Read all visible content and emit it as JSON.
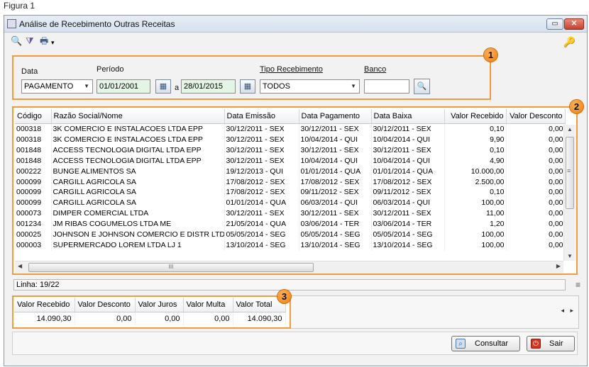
{
  "caption": "Figura 1",
  "window": {
    "title": "Análise de Recebimento Outras Receitas",
    "min_label": "▭",
    "close_label": "✕"
  },
  "toolbar": {
    "search_icon": "🔍",
    "filter_icon": "⧩",
    "print_icon": "🖶",
    "print_dropdown": "▾",
    "key_icon": "🔑"
  },
  "filters": {
    "data_label": "Data",
    "data_value": "PAGAMENTO",
    "periodo_label": "Período",
    "date_from": "01/01/2001",
    "date_sep": "a",
    "date_to": "28/01/2015",
    "tipo_label": "Tipo Recebimento",
    "tipo_value": "TODOS",
    "banco_label": "Banco",
    "banco_value": "",
    "cal_icon": "▦",
    "lookup_icon": "🔍"
  },
  "badges": [
    "1",
    "2",
    "3"
  ],
  "grid": {
    "columns": [
      "Código",
      "Razão Social/Nome",
      "Data Emissão",
      "Data Pagamento",
      "Data Baixa",
      "Valor Recebido",
      "Valor Desconto"
    ],
    "rows": [
      [
        "000318",
        "3K COMERCIO E INSTALACOES LTDA EPP",
        "30/12/2011 - SEX",
        "30/12/2011 - SEX",
        "30/12/2011 - SEX",
        "0,10",
        "0,00"
      ],
      [
        "000318",
        "3K COMERCIO E INSTALACOES LTDA EPP",
        "30/12/2011 - SEX",
        "10/04/2014 - QUI",
        "10/04/2014 - QUI",
        "9,90",
        "0,00"
      ],
      [
        "001848",
        "ACCESS TECNOLOGIA DIGITAL LTDA EPP",
        "30/12/2011 - SEX",
        "30/12/2011 - SEX",
        "30/12/2011 - SEX",
        "0,10",
        "0,00"
      ],
      [
        "001848",
        "ACCESS TECNOLOGIA DIGITAL LTDA EPP",
        "30/12/2011 - SEX",
        "10/04/2014 - QUI",
        "10/04/2014 - QUI",
        "4,90",
        "0,00"
      ],
      [
        "000222",
        "BUNGE ALIMENTOS SA",
        "19/12/2013 - QUI",
        "01/01/2014 - QUA",
        "01/01/2014 - QUA",
        "10.000,00",
        "0,00"
      ],
      [
        "000099",
        "CARGILL AGRICOLA SA",
        "17/08/2012 - SEX",
        "17/08/2012 - SEX",
        "17/08/2012 - SEX",
        "2.500,00",
        "0,00"
      ],
      [
        "000099",
        "CARGILL AGRICOLA SA",
        "17/08/2012 - SEX",
        "09/11/2012 - SEX",
        "09/11/2012 - SEX",
        "0,10",
        "0,00"
      ],
      [
        "000099",
        "CARGILL AGRICOLA SA",
        "01/01/2014 - QUA",
        "06/03/2014 - QUI",
        "06/03/2014 - QUI",
        "100,00",
        "0,00"
      ],
      [
        "000073",
        "DIMPER COMERCIAL LTDA",
        "30/12/2011 - SEX",
        "30/12/2011 - SEX",
        "30/12/2011 - SEX",
        "11,00",
        "0,00"
      ],
      [
        "001234",
        "JM RIBAS COGUMELOS LTDA ME",
        "21/05/2014 - QUA",
        "03/06/2014 - TER",
        "03/06/2014 - TER",
        "1,20",
        "0,00"
      ],
      [
        "000025",
        "JOHNSON E JOHNSON COMERCIO E DISTR LTD",
        "05/05/2014 - SEG",
        "05/05/2014 - SEG",
        "05/05/2014 - SEG",
        "100,00",
        "0,00"
      ],
      [
        "000003",
        "SUPERMERCADO LOREM LTDA LJ 1",
        "13/10/2014 - SEG",
        "13/10/2014 - SEG",
        "13/10/2014 - SEG",
        "100,00",
        "0,00"
      ]
    ],
    "hscroll_grip": "III",
    "vscroll_grip": "≡"
  },
  "status": {
    "linha": "Linha: 19/22",
    "menu_icon": "≡"
  },
  "totals": {
    "columns": [
      "Valor Recebido",
      "Valor Desconto",
      "Valor Juros",
      "Valor Multa",
      "Valor Total"
    ],
    "values": [
      "14.090,30",
      "0,00",
      "0,00",
      "0,00",
      "14.090,30"
    ],
    "arrows": "◂ ▸"
  },
  "buttons": {
    "consultar": "Consultar",
    "sair": "Sair"
  }
}
